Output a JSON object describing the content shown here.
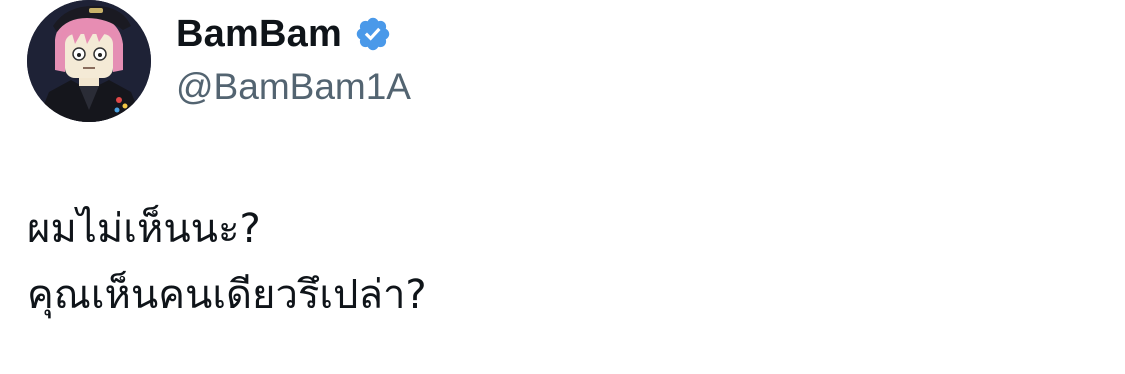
{
  "author": {
    "display_name": "BamBam",
    "handle": "@BamBam1A",
    "verified": true,
    "verified_color": "#4a99e9",
    "avatar_icon": "cartoon-avatar-pink-hair"
  },
  "tweet": {
    "lines": [
      "ผมไม่เห็นนะ?",
      "คุณเห็นคนเดียวรึเปล่า?"
    ]
  },
  "colors": {
    "name": "#0f1419",
    "handle": "#536471",
    "text": "#0f1419",
    "background": "#ffffff"
  }
}
